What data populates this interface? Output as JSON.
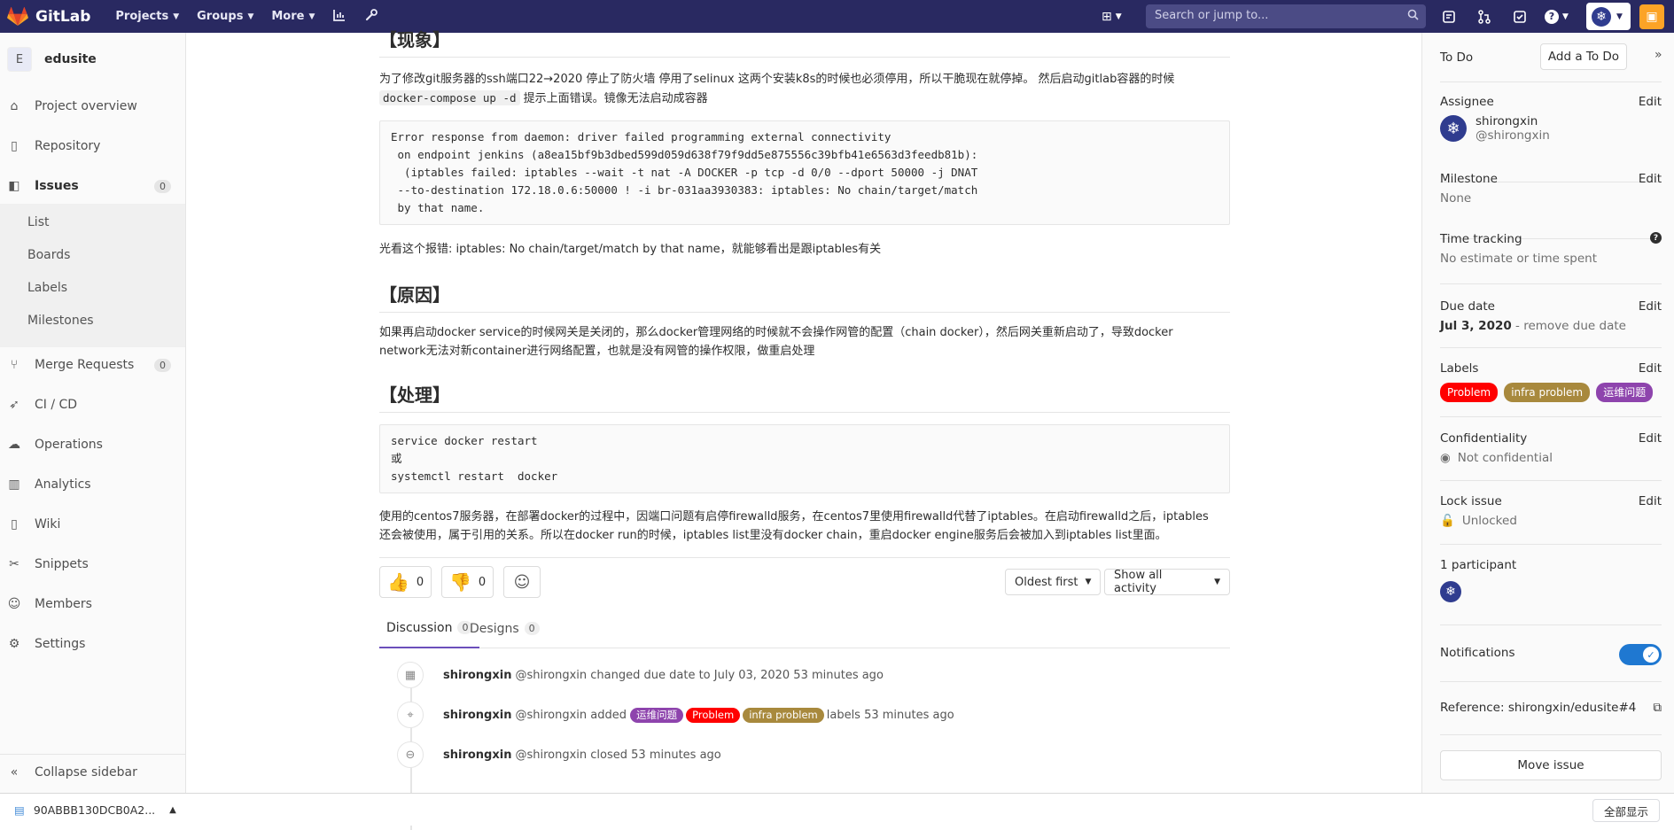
{
  "topbar": {
    "brand": "GitLab",
    "nav": [
      {
        "label": "Projects"
      },
      {
        "label": "Groups"
      },
      {
        "label": "More"
      }
    ],
    "search_placeholder": "Search or jump to..."
  },
  "sidebar": {
    "project_initial": "E",
    "project_name": "edusite",
    "items": [
      {
        "label": "Project overview",
        "icon": "home-icon"
      },
      {
        "label": "Repository",
        "icon": "book-icon"
      },
      {
        "label": "Issues",
        "icon": "issues-icon",
        "count": "0"
      },
      {
        "label": "Merge Requests",
        "icon": "merge-request-icon",
        "count": "0"
      },
      {
        "label": "CI / CD",
        "icon": "rocket-icon"
      },
      {
        "label": "Operations",
        "icon": "cloud-gear-icon"
      },
      {
        "label": "Analytics",
        "icon": "chart-icon"
      },
      {
        "label": "Wiki",
        "icon": "book-icon"
      },
      {
        "label": "Snippets",
        "icon": "scissors-icon"
      },
      {
        "label": "Members",
        "icon": "users-icon"
      },
      {
        "label": "Settings",
        "icon": "gear-icon"
      }
    ],
    "issues_sub": [
      "List",
      "Boards",
      "Labels",
      "Milestones"
    ],
    "collapse_label": "Collapse sidebar"
  },
  "content": {
    "heading_partial": "【现象】",
    "p1_line1": "为了修改git服务器的ssh端口22→2020 停止了防火墙 停用了selinux 这两个安装k8s的时候也必须停用，所以干脆现在就停掉。 然后启动gitlab容器的时候",
    "p1_code": "docker-compose up -d",
    "p1_line2": " 提示上面错误。镜像无法启动成容器",
    "error_block": "Error response from daemon: driver failed programming external connectivity\n on endpoint jenkins (a8ea15bf9b3dbed599d059d638f79f9dd5e875556c39bfb41e6563d3feedb81b):\n  (iptables failed: iptables --wait -t nat -A DOCKER -p tcp -d 0/0 --dport 50000 -j DNAT\n --to-destination 172.18.0.6:50000 ! -i br-031aa3930383: iptables: No chain/target/match\n by that name.",
    "p2": "光看这个报错: iptables: No chain/target/match by that name，就能够看出是跟iptables有关",
    "heading_cause": "【原因】",
    "p3_line1": "如果再启动docker service的时候网关是关闭的，那么docker管理网络的时候就不会操作网管的配置（chain docker），然后网关重新启动了，导致docker",
    "p3_line2": "network无法对新container进行网络配置，也就是没有网管的操作权限，做重启处理",
    "heading_fix": "【处理】",
    "fix_block": "service docker restart\n或\nsystemctl restart  docker",
    "p4_line1": "使用的centos7服务器，在部署docker的过程中，因端口问题有启停firewalld服务，在centos7里使用firewalld代替了iptables。在启动firewalld之后，iptables",
    "p4_line2": "还会被使用，属于引用的关系。所以在docker run的时候，iptables list里没有docker chain，重启docker engine服务后会被加入到iptables list里面。"
  },
  "awards": {
    "thumbs_up": "0",
    "thumbs_down": "0"
  },
  "sort": {
    "order": "Oldest first",
    "filter": "Show all activity"
  },
  "tabs": [
    {
      "label": "Discussion",
      "count": "0"
    },
    {
      "label": "Designs",
      "count": "0"
    }
  ],
  "notes": [
    {
      "icon": "calendar-icon",
      "author": "shirongxin",
      "handle": "@shirongxin",
      "text": "changed due date to July 03, 2020 53 minutes ago"
    },
    {
      "icon": "tag-icon",
      "author": "shirongxin",
      "handle": "@shirongxin",
      "pre": "added",
      "labels": [
        "运维问题",
        "Problem",
        "infra problem"
      ],
      "post": "labels 53 minutes ago"
    },
    {
      "icon": "circle-minus-icon",
      "author": "shirongxin",
      "handle": "@shirongxin",
      "text": "closed 53 minutes ago"
    }
  ],
  "label_colors": {
    "运维问题": "#8e44ad",
    "Problem": "#ff0000",
    "infra problem": "#a8893d"
  },
  "right_sidebar": {
    "todo": "To Do",
    "add_todo": "Add a To Do",
    "assignee_title": "Assignee",
    "edit": "Edit",
    "assignee_name": "shirongxin",
    "assignee_handle": "@shirongxin",
    "milestone_title": "Milestone",
    "milestone_value": "None",
    "time_tracking_title": "Time tracking",
    "time_tracking_value": "No estimate or time spent",
    "due_date_title": "Due date",
    "due_date_value": "Jul 3, 2020",
    "due_date_remove": " - remove due date",
    "labels_title": "Labels",
    "labels": [
      "Problem",
      "infra problem",
      "运维问题"
    ],
    "confidentiality_title": "Confidentiality",
    "confidentiality_value": "Not confidential",
    "lock_title": "Lock issue",
    "lock_value": "Unlocked",
    "participants": "1 participant",
    "notifications": "Notifications",
    "reference": "Reference: shirongxin/edusite#4",
    "move_issue": "Move issue"
  },
  "download_bar": {
    "file": "90ABBB130DCB0A2...",
    "show_all": "全部显示"
  }
}
